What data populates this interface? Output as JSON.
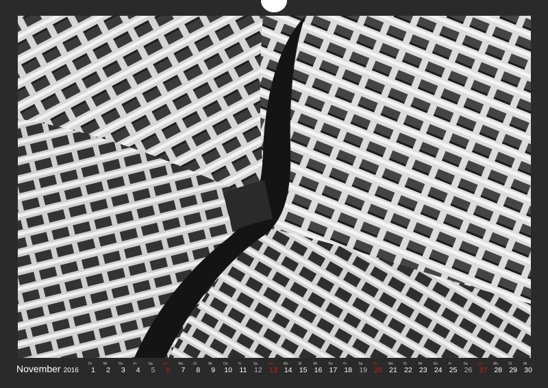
{
  "calendar": {
    "month": "November",
    "year": "2016",
    "days": [
      {
        "wd": "Di",
        "n": "1",
        "t": "w"
      },
      {
        "wd": "Mi",
        "n": "2",
        "t": "w"
      },
      {
        "wd": "Do",
        "n": "3",
        "t": "w"
      },
      {
        "wd": "Fr",
        "n": "4",
        "t": "w"
      },
      {
        "wd": "Sa",
        "n": "5",
        "t": "sat"
      },
      {
        "wd": "So",
        "n": "6",
        "t": "sun"
      },
      {
        "wd": "Mo",
        "n": "7",
        "t": "w"
      },
      {
        "wd": "Di",
        "n": "8",
        "t": "w"
      },
      {
        "wd": "Mi",
        "n": "9",
        "t": "w"
      },
      {
        "wd": "Do",
        "n": "10",
        "t": "w"
      },
      {
        "wd": "Fr",
        "n": "11",
        "t": "w"
      },
      {
        "wd": "Sa",
        "n": "12",
        "t": "sat"
      },
      {
        "wd": "So",
        "n": "13",
        "t": "sun"
      },
      {
        "wd": "Mo",
        "n": "14",
        "t": "w"
      },
      {
        "wd": "Di",
        "n": "15",
        "t": "w"
      },
      {
        "wd": "Mi",
        "n": "16",
        "t": "w"
      },
      {
        "wd": "Do",
        "n": "17",
        "t": "w"
      },
      {
        "wd": "Fr",
        "n": "18",
        "t": "w"
      },
      {
        "wd": "Sa",
        "n": "19",
        "t": "sat"
      },
      {
        "wd": "So",
        "n": "20",
        "t": "sun"
      },
      {
        "wd": "Mo",
        "n": "21",
        "t": "w"
      },
      {
        "wd": "Di",
        "n": "22",
        "t": "w"
      },
      {
        "wd": "Mi",
        "n": "23",
        "t": "w"
      },
      {
        "wd": "Do",
        "n": "24",
        "t": "w"
      },
      {
        "wd": "Fr",
        "n": "25",
        "t": "w"
      },
      {
        "wd": "Sa",
        "n": "26",
        "t": "sat"
      },
      {
        "wd": "So",
        "n": "27",
        "t": "sun"
      },
      {
        "wd": "Mo",
        "n": "28",
        "t": "w"
      },
      {
        "wd": "Di",
        "n": "29",
        "t": "w"
      },
      {
        "wd": "Mi",
        "n": "30",
        "t": "w"
      }
    ]
  },
  "colors": {
    "background": "#2b2a2a",
    "text": "#ffffff",
    "sunday": "#d81818",
    "saturday": "#b9b9b9"
  }
}
